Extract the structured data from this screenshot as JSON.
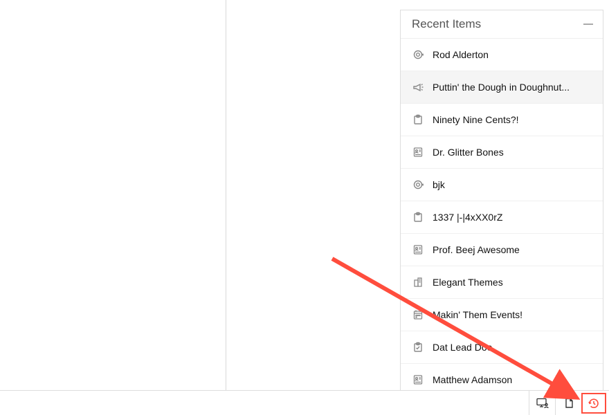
{
  "panel": {
    "title": "Recent Items",
    "items": [
      {
        "icon": "target-icon",
        "label": "Rod Alderton"
      },
      {
        "icon": "megaphone-icon",
        "label": "Puttin' the Dough in Doughnut...",
        "hover": true
      },
      {
        "icon": "note-icon",
        "label": "Ninety Nine Cents?!"
      },
      {
        "icon": "id-card-icon",
        "label": "Dr. Glitter Bones"
      },
      {
        "icon": "target-icon",
        "label": "bjk"
      },
      {
        "icon": "note-icon",
        "label": "1337 |-|4xXX0rZ"
      },
      {
        "icon": "id-card-icon",
        "label": "Prof. Beej Awesome"
      },
      {
        "icon": "building-icon",
        "label": "Elegant Themes"
      },
      {
        "icon": "calendar-icon",
        "label": "Makin' Them Events!"
      },
      {
        "icon": "checklist-icon",
        "label": "Dat Lead Doe"
      },
      {
        "icon": "id-card-icon",
        "label": "Matthew Adamson"
      }
    ]
  },
  "bottombar": {
    "buttons": [
      {
        "name": "screen-share-button",
        "icon": "monitor-user-icon"
      },
      {
        "name": "document-button",
        "icon": "document-icon"
      },
      {
        "name": "recent-items-button",
        "icon": "clock-history-icon"
      }
    ]
  },
  "annotation": {
    "arrow_color": "#ff4d3d"
  }
}
